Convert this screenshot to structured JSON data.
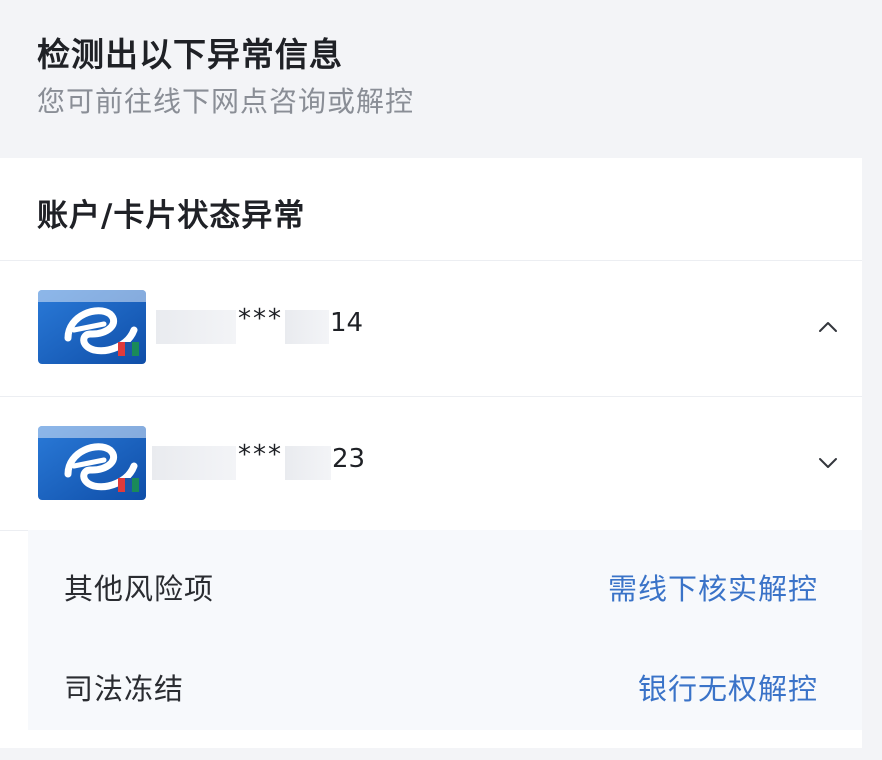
{
  "header": {
    "title": "检测出以下异常信息",
    "subtitle": "您可前往线下网点咨询或解控"
  },
  "section": {
    "title": "账户/卡片状态异常"
  },
  "cards": [
    {
      "stars": "***",
      "suffix": "14",
      "expanded": true,
      "chevron": "chevron-up-icon"
    },
    {
      "stars": "***",
      "suffix": "23",
      "expanded": false,
      "chevron": "chevron-down-icon"
    }
  ],
  "details": [
    {
      "label": "其他风险项",
      "action": "需线下核实解控"
    },
    {
      "label": "司法冻结",
      "action": "银行无权解控"
    }
  ],
  "colors": {
    "background": "#f3f4f7",
    "panel": "#ffffff",
    "detail_bg": "#f7f9fc",
    "action_blue": "#3a73c8",
    "card_blue": "#1c64c8"
  }
}
